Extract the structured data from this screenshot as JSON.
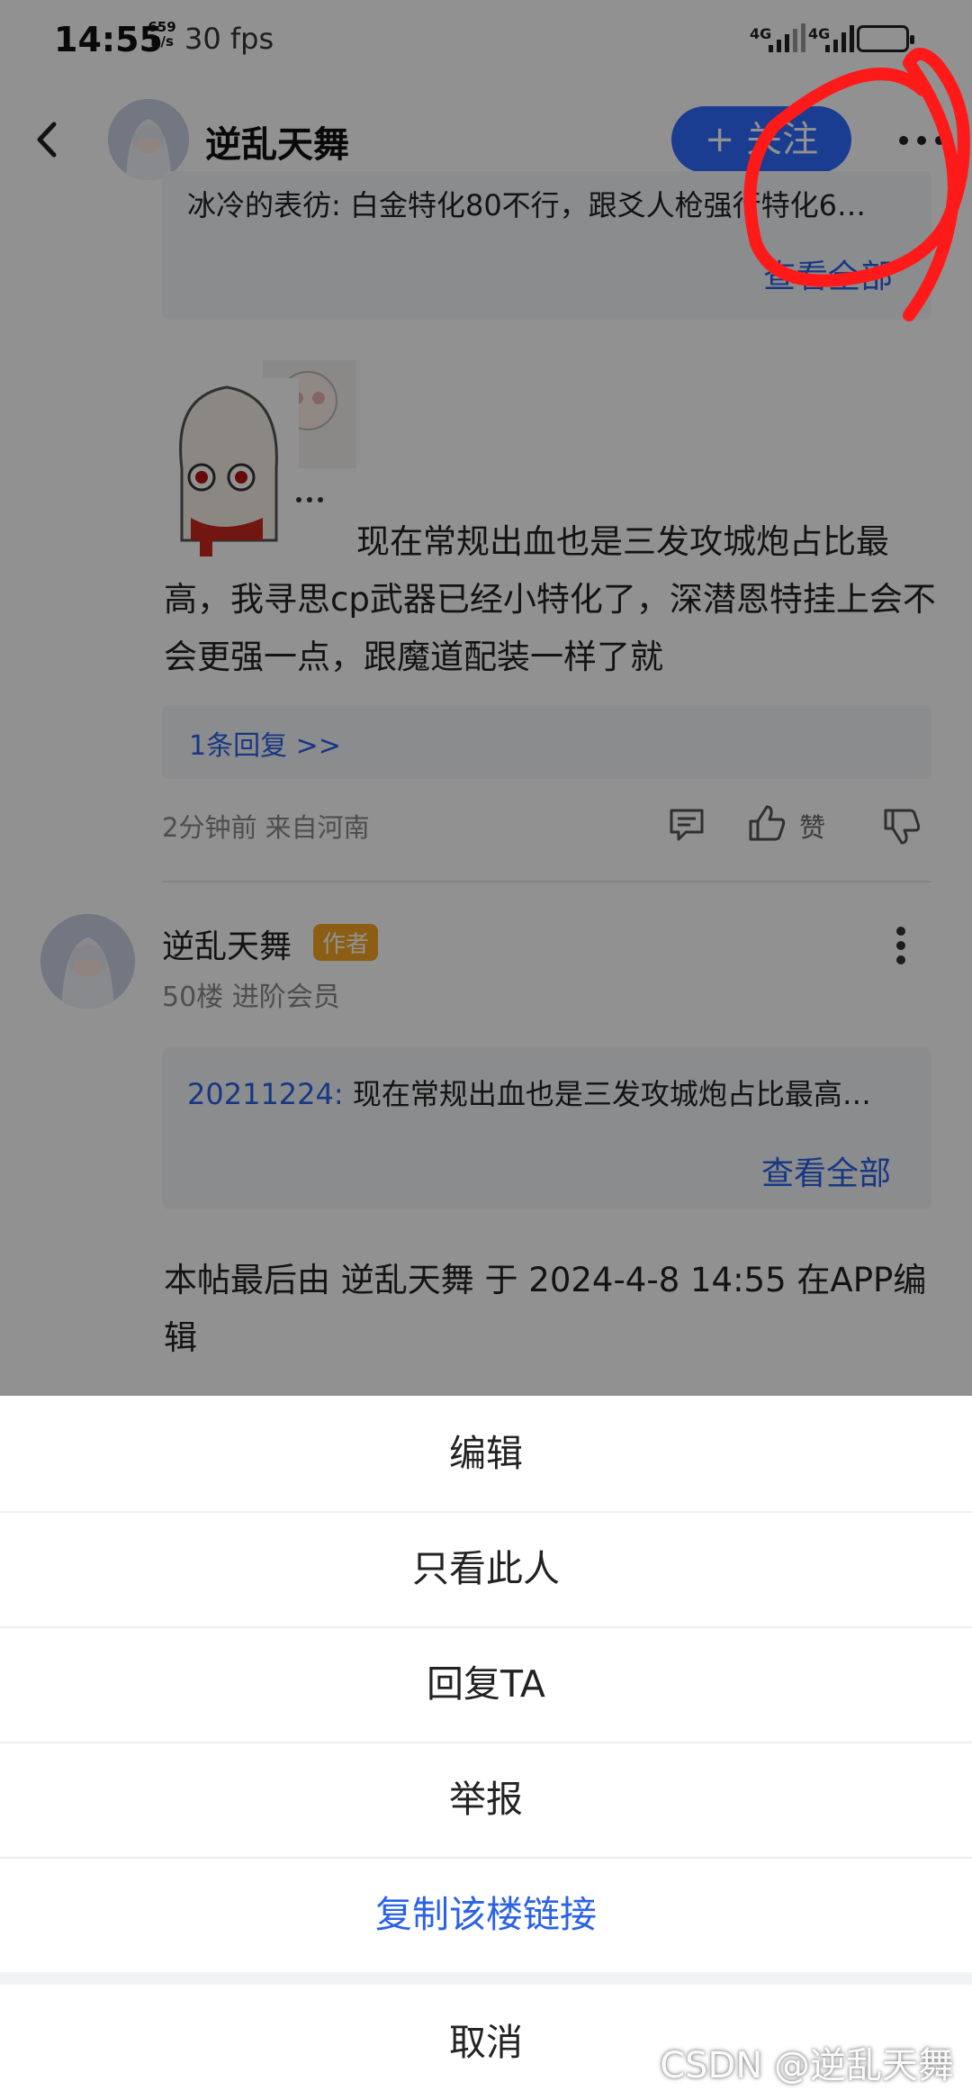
{
  "status_bar": {
    "time": "14:55",
    "speed_line1": "659",
    "speed_line2": "B/s",
    "fps": "30 fps",
    "network1": "4G",
    "network2": "4G"
  },
  "header": {
    "username": "逆乱天舞",
    "follow_label": "+ 关注"
  },
  "top_quote": {
    "text": "冰冷的表彷: 白金特化80不行，跟爻人枪强行特化6…",
    "view_all": "查看全部"
  },
  "post1": {
    "text": "现在常规出血也是三发攻城炮占比最高，我寻思cp武器已经小特化了，深潜恩特挂上会不会更强一点，跟魔道配装一样了就",
    "replies_link": "1条回复 >>",
    "meta": "2分钟前 来自河南",
    "like_label": "赞"
  },
  "post2": {
    "username": "逆乱天舞",
    "author_tag": "作者",
    "meta": "50楼 进阶会员",
    "quote_user": "20211224:",
    "quote_text": " 现在常规出血也是三发攻城炮占比最高…",
    "view_all": "查看全部",
    "edit_note": "本帖最后由 逆乱天舞 于 2024-4-8 14:55 在APP编辑"
  },
  "action_sheet": {
    "items": [
      {
        "label": "编辑"
      },
      {
        "label": "只看此人"
      },
      {
        "label": "回复TA"
      },
      {
        "label": "举报"
      },
      {
        "label": "复制该楼链接"
      }
    ],
    "cancel": "取消"
  },
  "watermark": "CSDN @逆乱天舞",
  "colors": {
    "accent_blue": "#2f6bff",
    "link_blue": "#2b62e6",
    "author_tag": "#f5a623",
    "annotation_red": "#ff1a1a"
  }
}
